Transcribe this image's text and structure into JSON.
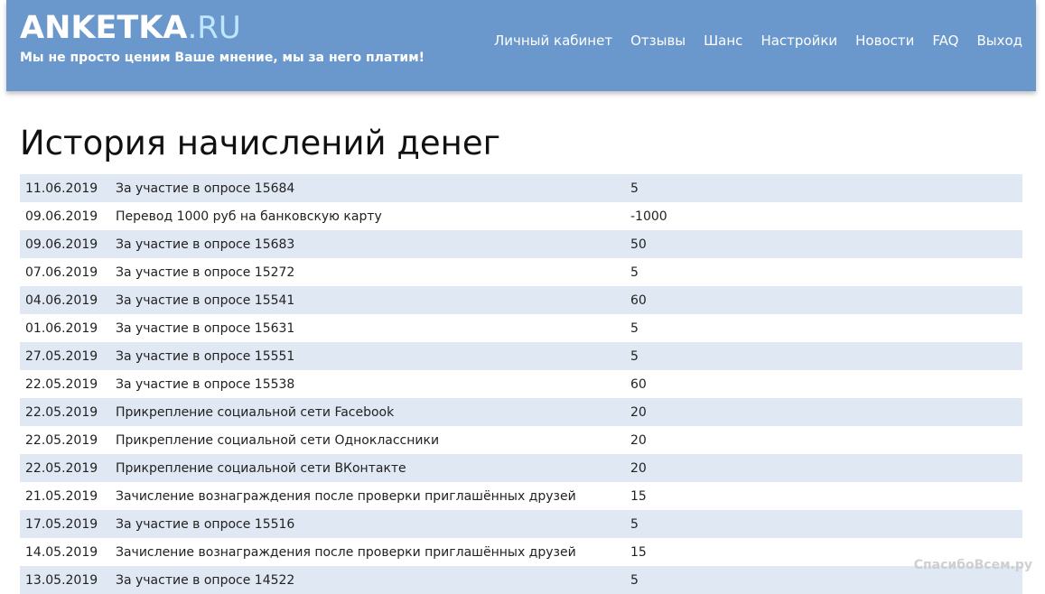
{
  "site": {
    "logo_main": "ANKETKA",
    "logo_domain": ".RU",
    "tagline": "Мы не просто ценим Ваше мнение, мы за него платим!"
  },
  "nav": {
    "items": [
      {
        "label": "Личный кабинет"
      },
      {
        "label": "Отзывы"
      },
      {
        "label": "Шанс"
      },
      {
        "label": "Настройки"
      },
      {
        "label": "Новости"
      },
      {
        "label": "FAQ"
      },
      {
        "label": "Выход"
      }
    ]
  },
  "page": {
    "title": "История начислений денег"
  },
  "history": {
    "rows": [
      {
        "date": "11.06.2019",
        "description": "За участие в опросе 15684",
        "amount": "5"
      },
      {
        "date": "09.06.2019",
        "description": "Перевод 1000 руб на банковскую карту",
        "amount": "-1000"
      },
      {
        "date": "09.06.2019",
        "description": "За участие в опросе 15683",
        "amount": "50"
      },
      {
        "date": "07.06.2019",
        "description": "За участие в опросе 15272",
        "amount": "5"
      },
      {
        "date": "04.06.2019",
        "description": "За участие в опросе 15541",
        "amount": "60"
      },
      {
        "date": "01.06.2019",
        "description": "За участие в опросе 15631",
        "amount": "5"
      },
      {
        "date": "27.05.2019",
        "description": "За участие в опросе 15551",
        "amount": "5"
      },
      {
        "date": "22.05.2019",
        "description": "За участие в опросе 15538",
        "amount": "60"
      },
      {
        "date": "22.05.2019",
        "description": "Прикрепление социальной сети Facebook",
        "amount": "20"
      },
      {
        "date": "22.05.2019",
        "description": "Прикрепление социальной сети Одноклассники",
        "amount": "20"
      },
      {
        "date": "22.05.2019",
        "description": "Прикрепление социальной сети ВКонтакте",
        "amount": "20"
      },
      {
        "date": "21.05.2019",
        "description": "Зачисление вознаграждения после проверки приглашённых друзей",
        "amount": "15"
      },
      {
        "date": "17.05.2019",
        "description": "За участие в опросе 15516",
        "amount": "5"
      },
      {
        "date": "14.05.2019",
        "description": "Зачисление вознаграждения после проверки приглашённых друзей",
        "amount": "15"
      },
      {
        "date": "13.05.2019",
        "description": "За участие в опросе 14522",
        "amount": "5"
      }
    ]
  },
  "watermark": {
    "text": "СпасибоВсем.ру"
  },
  "colors": {
    "header_bg": "#6a98cc",
    "logo_domain": "#bfe6ff",
    "row_stripe": "#e0e8f3"
  }
}
